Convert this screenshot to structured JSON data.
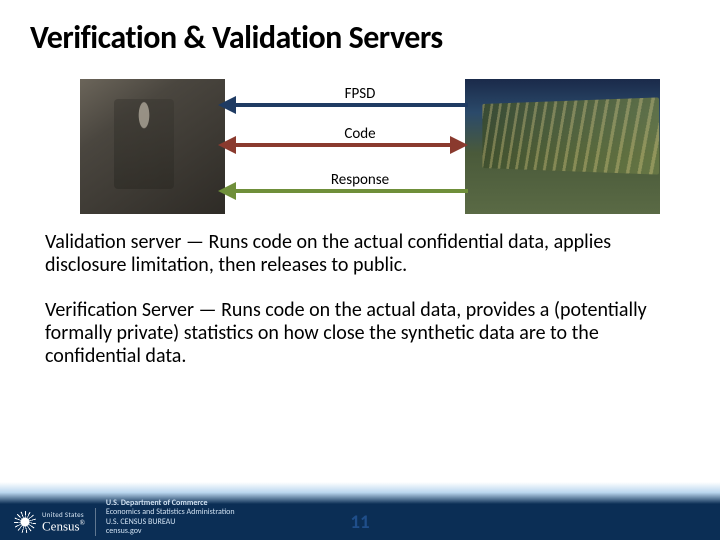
{
  "title": "Verification & Validation Servers",
  "diagram": {
    "labels": {
      "top": "FPSD",
      "middle": "Code",
      "bottom": "Response"
    }
  },
  "paragraphs": {
    "p1": "Validation server — Runs code on the actual confidential data, applies disclosure limitation, then releases to public.",
    "p2": "Verification Server — Runs code on the actual data, provides a (potentially formally private) statistics on how close the synthetic data are to the confidential data."
  },
  "footer": {
    "us_tag": "United States",
    "census_word": "Census",
    "dept_line1": "U.S. Department of Commerce",
    "dept_line2": "Economics and Statistics Administration",
    "dept_line3": "U.S. CENSUS BUREAU",
    "dept_line4": "census.gov"
  },
  "page_number": "11"
}
